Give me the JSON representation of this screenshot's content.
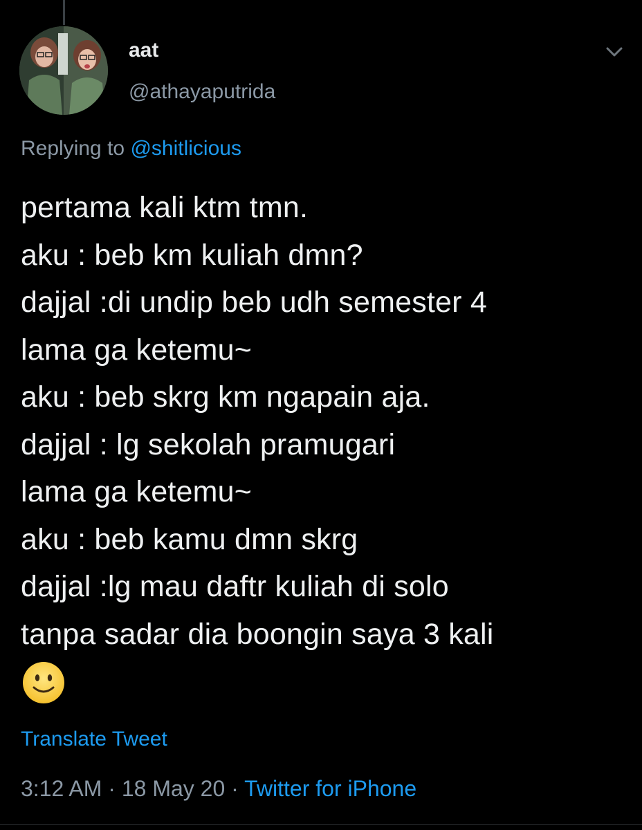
{
  "tweet": {
    "author": {
      "display_name": "aat",
      "handle": "@athayaputrida"
    },
    "reply_prefix": "Replying to ",
    "reply_to": "@shitlicious",
    "text": "pertama kali ktm tmn.\naku : beb km kuliah dmn?\ndajjal :di undip beb udh semester 4\nlama ga ketemu~\naku : beb skrg km ngapain aja.\ndajjal : lg sekolah pramugari\nlama ga ketemu~\naku : beb kamu dmn skrg\ndajjal :lg mau daftr kuliah di solo\ntanpa sadar dia boongin saya 3 kali",
    "emoji": "slightly-smiling-face",
    "translate_label": "Translate Tweet",
    "time": "3:12 AM",
    "separator": " · ",
    "date": "18 May 20",
    "source": "Twitter for iPhone"
  },
  "colors": {
    "background": "#000000",
    "text": "#e7e9ea",
    "secondary": "#8b98a5",
    "accent": "#1d9bf0"
  }
}
